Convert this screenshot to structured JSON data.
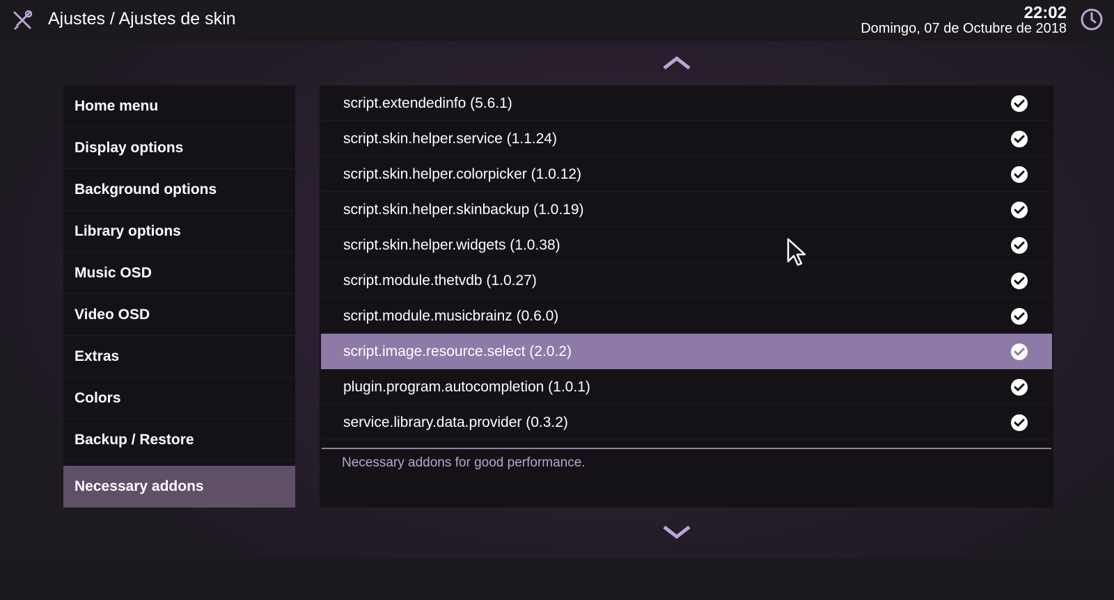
{
  "header": {
    "title": "Ajustes / Ajustes de skin",
    "time": "22:02",
    "date": "Domingo, 07 de Octubre de 2018",
    "logo_icon": "settings-tools-icon",
    "clock_icon": "clock-icon"
  },
  "sidebar": {
    "items": [
      {
        "label": "Home menu"
      },
      {
        "label": "Display options"
      },
      {
        "label": "Background options"
      },
      {
        "label": "Library options"
      },
      {
        "label": "Music OSD"
      },
      {
        "label": "Video OSD"
      },
      {
        "label": "Extras"
      },
      {
        "label": "Colors"
      },
      {
        "label": "Backup / Restore"
      },
      {
        "label": "Necessary addons",
        "selected": true
      }
    ]
  },
  "addons": {
    "items": [
      {
        "label": "script.extendedinfo (5.6.1)",
        "installed": true
      },
      {
        "label": "script.skin.helper.service (1.1.24)",
        "installed": true
      },
      {
        "label": "script.skin.helper.colorpicker (1.0.12)",
        "installed": true
      },
      {
        "label": "script.skin.helper.skinbackup (1.0.19)",
        "installed": true
      },
      {
        "label": "script.skin.helper.widgets (1.0.38)",
        "installed": true
      },
      {
        "label": "script.module.thetvdb (1.0.27)",
        "installed": true
      },
      {
        "label": "script.module.musicbrainz (0.6.0)",
        "installed": true
      },
      {
        "label": "script.image.resource.select (2.0.2)",
        "installed": true,
        "selected": true
      },
      {
        "label": "plugin.program.autocompletion (1.0.1)",
        "installed": true
      },
      {
        "label": "service.library.data.provider (0.3.2)",
        "installed": true
      }
    ],
    "description": "Necessary addons for good performance."
  },
  "colors": {
    "accent": "#8d7aa8",
    "sidebar_selected": "#5f5068",
    "description_text": "#b8a4d4",
    "panel_bg": "#141216"
  }
}
